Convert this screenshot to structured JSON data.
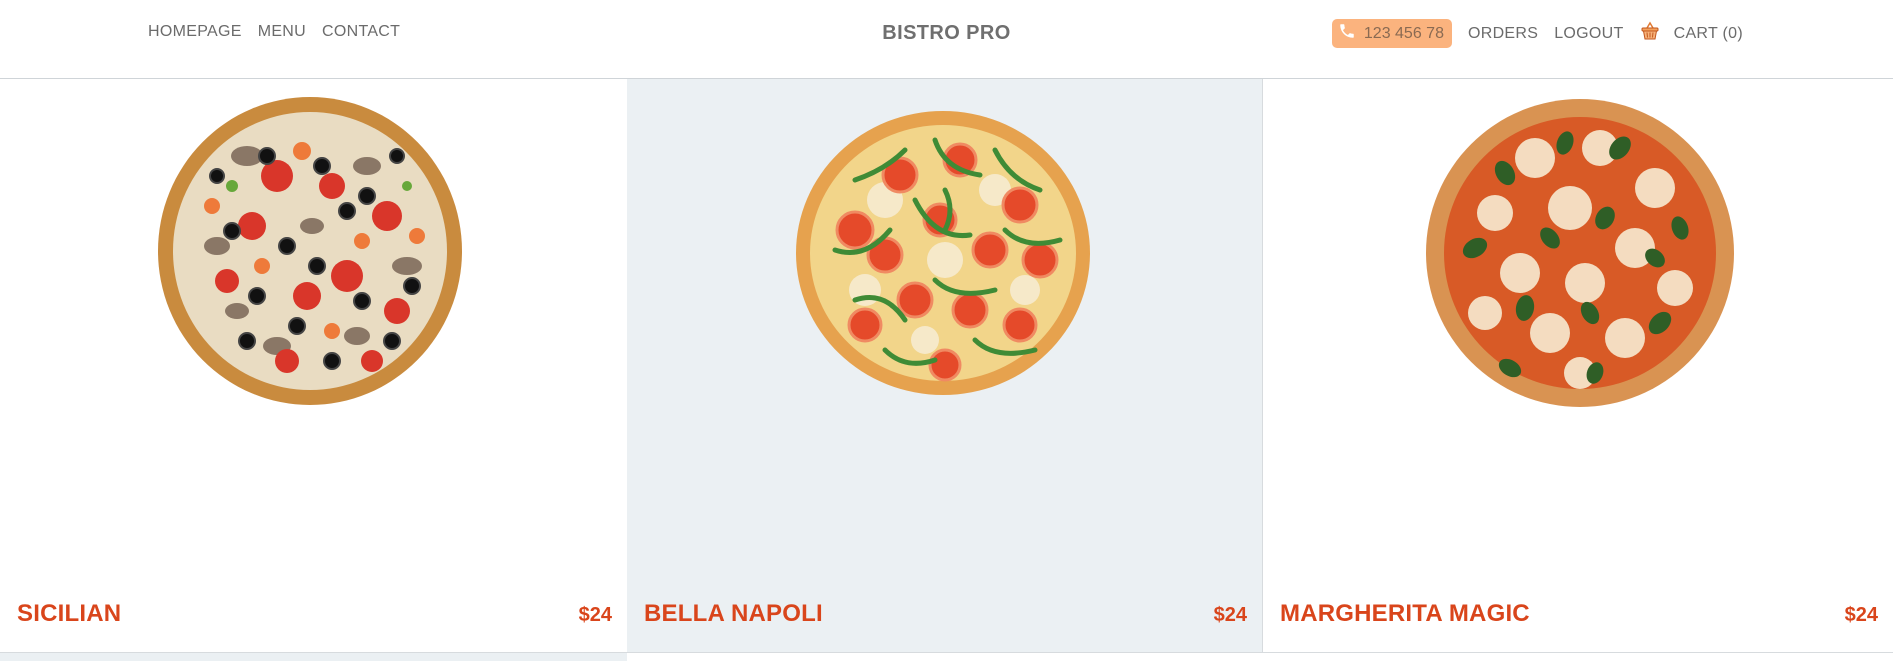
{
  "header": {
    "nav_left": [
      "HOMEPAGE",
      "MENU",
      "CONTACT"
    ],
    "brand": "BISTRO PRO",
    "phone": "123 456 78",
    "orders": "ORDERS",
    "logout": "LOGOUT",
    "cart": "CART (0)"
  },
  "products": [
    {
      "name": "SICILIAN",
      "price": "$24"
    },
    {
      "name": "BELLA NAPOLI",
      "price": "$24"
    },
    {
      "name": "MARGHERITA MAGIC",
      "price": "$24"
    }
  ],
  "colors": {
    "accent": "#d9451b",
    "phone_pill": "#fbb37e",
    "active_card_bg": "#ebf0f3"
  },
  "icons": {
    "phone": "phone-icon",
    "cart": "basket-icon"
  }
}
